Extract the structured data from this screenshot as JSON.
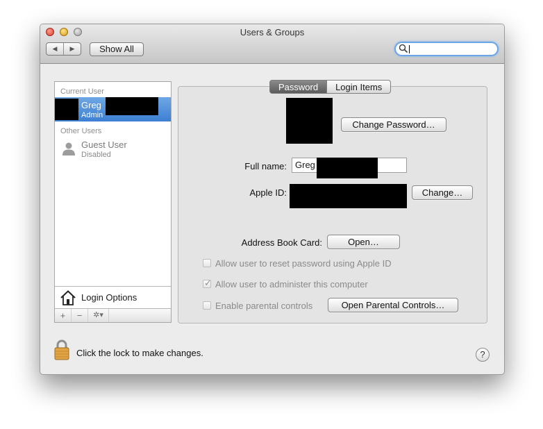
{
  "window": {
    "title": "Users & Groups"
  },
  "toolbar": {
    "back_glyph": "◀",
    "forward_glyph": "▶",
    "show_all_label": "Show All",
    "search_value": ""
  },
  "sidebar": {
    "current_user_header": "Current User",
    "current_user": {
      "name": "Greg",
      "role": "Admin"
    },
    "other_users_header": "Other Users",
    "guest_user": {
      "name": "Guest User",
      "status": "Disabled"
    },
    "login_options_label": "Login Options",
    "add_glyph": "+",
    "remove_glyph": "−",
    "action_glyph": "✲▾"
  },
  "tabs": [
    {
      "label": "Password",
      "active": true
    },
    {
      "label": "Login Items",
      "active": false
    }
  ],
  "password_pane": {
    "change_password_label": "Change Password…",
    "full_name_label": "Full name:",
    "full_name_value": "Greg",
    "apple_id_label": "Apple ID:",
    "apple_id_change_label": "Change…",
    "address_book_label": "Address Book Card:",
    "open_label": "Open…",
    "options": [
      {
        "label": "Allow user to reset password using Apple ID",
        "checked": false
      },
      {
        "label": "Allow user to administer this computer",
        "checked": true
      },
      {
        "label": "Enable parental controls",
        "checked": false
      }
    ],
    "open_parental_label": "Open Parental Controls…"
  },
  "footer": {
    "lock_text": "Click the lock to make changes.",
    "help_glyph": "?"
  },
  "colors": {
    "selection": "#3d7fd3",
    "search_focus": "#6aa5e8",
    "disabled_text": "#8a8a8a"
  }
}
